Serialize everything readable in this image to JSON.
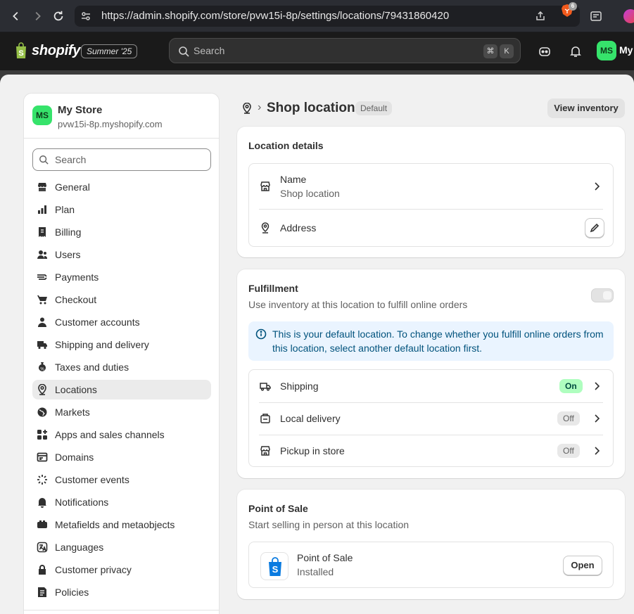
{
  "browser": {
    "url": "https://admin.shopify.com/store/pvw15i-8p/settings/locations/79431860420",
    "shields_count": "6"
  },
  "topbar": {
    "logo_text": "shopify",
    "edition_badge": "Summer '25",
    "search_placeholder": "Search",
    "shortcut_cmd": "⌘",
    "shortcut_key": "K",
    "store_initials": "MS",
    "store_short": "My"
  },
  "sidebar": {
    "store_initials": "MS",
    "store_name": "My Store",
    "store_domain": "pvw15i-8p.myshopify.com",
    "search_placeholder": "Search",
    "active": "Locations",
    "items": [
      {
        "label": "General",
        "icon": "store-icon"
      },
      {
        "label": "Plan",
        "icon": "plan-icon"
      },
      {
        "label": "Billing",
        "icon": "billing-icon"
      },
      {
        "label": "Users",
        "icon": "users-icon"
      },
      {
        "label": "Payments",
        "icon": "payments-icon"
      },
      {
        "label": "Checkout",
        "icon": "cart-icon"
      },
      {
        "label": "Customer accounts",
        "icon": "person-icon"
      },
      {
        "label": "Shipping and delivery",
        "icon": "truck-icon"
      },
      {
        "label": "Taxes and duties",
        "icon": "tax-icon"
      },
      {
        "label": "Locations",
        "icon": "location-pin-icon"
      },
      {
        "label": "Markets",
        "icon": "globe-icon"
      },
      {
        "label": "Apps and sales channels",
        "icon": "apps-icon"
      },
      {
        "label": "Domains",
        "icon": "domain-icon"
      },
      {
        "label": "Customer events",
        "icon": "events-icon"
      },
      {
        "label": "Notifications",
        "icon": "bell-icon"
      },
      {
        "label": "Metafields and metaobjects",
        "icon": "metafields-icon"
      },
      {
        "label": "Languages",
        "icon": "languages-icon"
      },
      {
        "label": "Customer privacy",
        "icon": "lock-icon"
      },
      {
        "label": "Policies",
        "icon": "policies-icon"
      }
    ]
  },
  "header": {
    "title": "Shop location",
    "badge": "Default",
    "view_inventory": "View inventory"
  },
  "location_details": {
    "title": "Location details",
    "name_label": "Name",
    "name_value": "Shop location",
    "address_label": "Address"
  },
  "fulfillment": {
    "title": "Fulfillment",
    "subtitle": "Use inventory at this location to fulfill online orders",
    "toggle_on": false,
    "banner": "This is your default location. To change whether you fulfill online orders from this location, select another default location first.",
    "rows": [
      {
        "label": "Shipping",
        "status": "On"
      },
      {
        "label": "Local delivery",
        "status": "Off"
      },
      {
        "label": "Pickup in store",
        "status": "Off"
      }
    ]
  },
  "pos": {
    "title": "Point of Sale",
    "subtitle": "Start selling in person at this location",
    "app_name": "Point of Sale",
    "app_status": "Installed",
    "open_label": "Open"
  }
}
